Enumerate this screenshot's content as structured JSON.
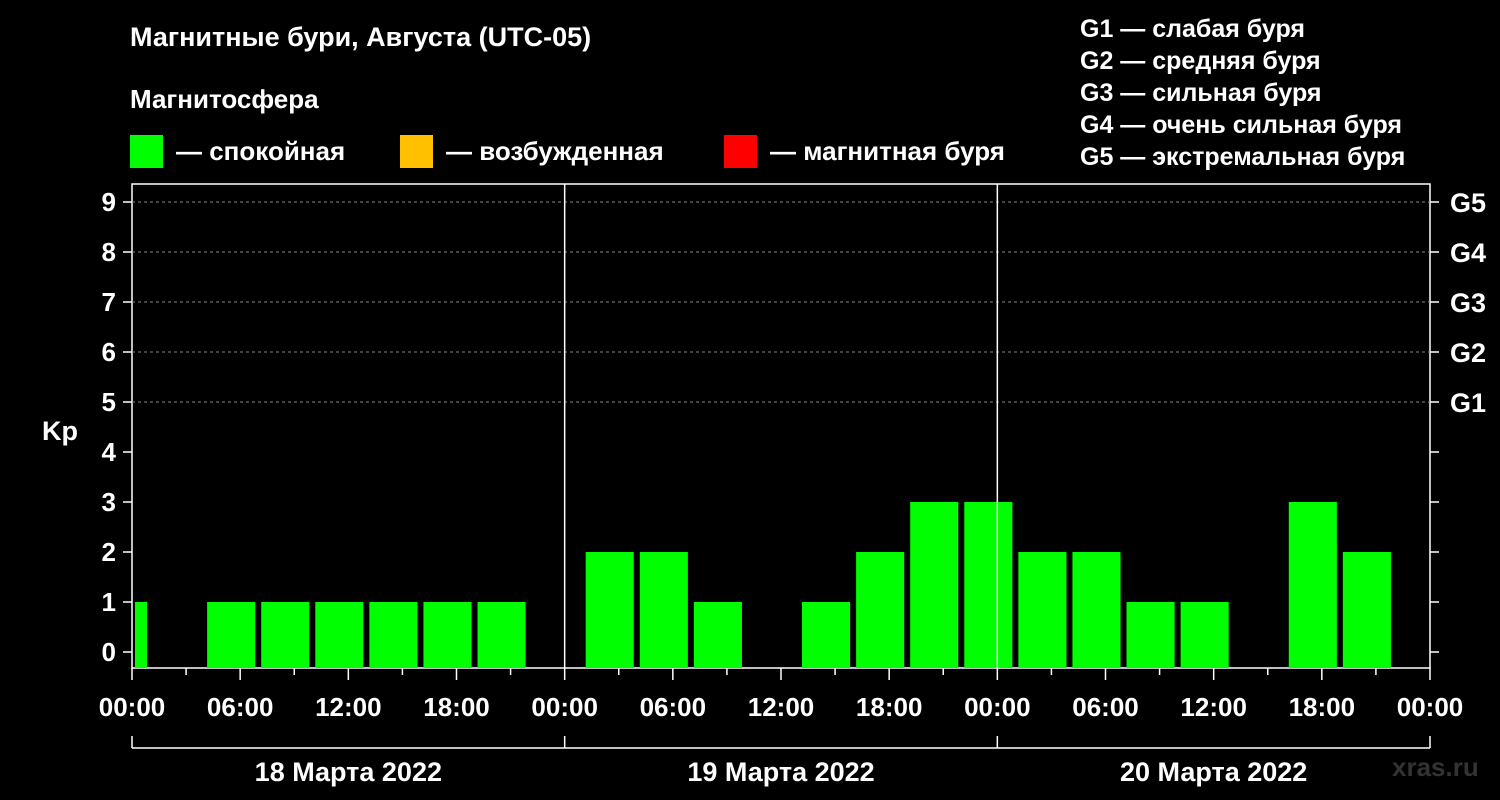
{
  "header": {
    "title": "Магнитные бури, Августа (UTC-05)",
    "subtitle": "Магнитосфера"
  },
  "legend": [
    {
      "label": "— спокойная",
      "color": "#00ff00"
    },
    {
      "label": "— возбужденная",
      "color": "#ffc000"
    },
    {
      "label": "— магнитная буря",
      "color": "#ff0000"
    }
  ],
  "g_levels": [
    "G1 — слабая буря",
    "G2 — средняя буря",
    "G3 — сильная буря",
    "G4 — очень сильная буря",
    "G5 — экстремальная буря"
  ],
  "watermark": "xras.ru",
  "chart_data": {
    "type": "bar",
    "ylabel": "Kp",
    "ylim": [
      0,
      9
    ],
    "yticks": [
      "0",
      "1",
      "2",
      "3",
      "4",
      "5",
      "6",
      "7",
      "8",
      "9"
    ],
    "right_ticks": [
      {
        "kp": 5,
        "label": "G1"
      },
      {
        "kp": 6,
        "label": "G2"
      },
      {
        "kp": 7,
        "label": "G3"
      },
      {
        "kp": 8,
        "label": "G4"
      },
      {
        "kp": 9,
        "label": "G5"
      }
    ],
    "x_tick_labels": [
      "00:00",
      "06:00",
      "12:00",
      "18:00",
      "00:00",
      "06:00",
      "12:00",
      "18:00",
      "00:00",
      "06:00",
      "12:00",
      "18:00",
      "00:00"
    ],
    "days": [
      "18 Марта 2022",
      "19 Марта 2022",
      "20 Марта 2022"
    ],
    "grid": "dashed horizontal at Kp 5-9",
    "bar_color": "#00ff00",
    "bar_interval_hours": 3,
    "bars": [
      {
        "start_hour": 0,
        "end_hour": 1,
        "kp": 1
      },
      {
        "start_hour": 4,
        "end_hour": 7,
        "kp": 1
      },
      {
        "start_hour": 7,
        "end_hour": 10,
        "kp": 1
      },
      {
        "start_hour": 10,
        "end_hour": 13,
        "kp": 1
      },
      {
        "start_hour": 13,
        "end_hour": 16,
        "kp": 1
      },
      {
        "start_hour": 16,
        "end_hour": 19,
        "kp": 1
      },
      {
        "start_hour": 19,
        "end_hour": 22,
        "kp": 1
      },
      {
        "start_hour": 25,
        "end_hour": 28,
        "kp": 2
      },
      {
        "start_hour": 28,
        "end_hour": 31,
        "kp": 2
      },
      {
        "start_hour": 31,
        "end_hour": 34,
        "kp": 1
      },
      {
        "start_hour": 37,
        "end_hour": 40,
        "kp": 1
      },
      {
        "start_hour": 40,
        "end_hour": 43,
        "kp": 2
      },
      {
        "start_hour": 43,
        "end_hour": 46,
        "kp": 3
      },
      {
        "start_hour": 46,
        "end_hour": 49,
        "kp": 3
      },
      {
        "start_hour": 49,
        "end_hour": 52,
        "kp": 2
      },
      {
        "start_hour": 52,
        "end_hour": 55,
        "kp": 2
      },
      {
        "start_hour": 55,
        "end_hour": 58,
        "kp": 1
      },
      {
        "start_hour": 58,
        "end_hour": 61,
        "kp": 1
      },
      {
        "start_hour": 64,
        "end_hour": 67,
        "kp": 3
      },
      {
        "start_hour": 67,
        "end_hour": 70,
        "kp": 2
      }
    ]
  }
}
